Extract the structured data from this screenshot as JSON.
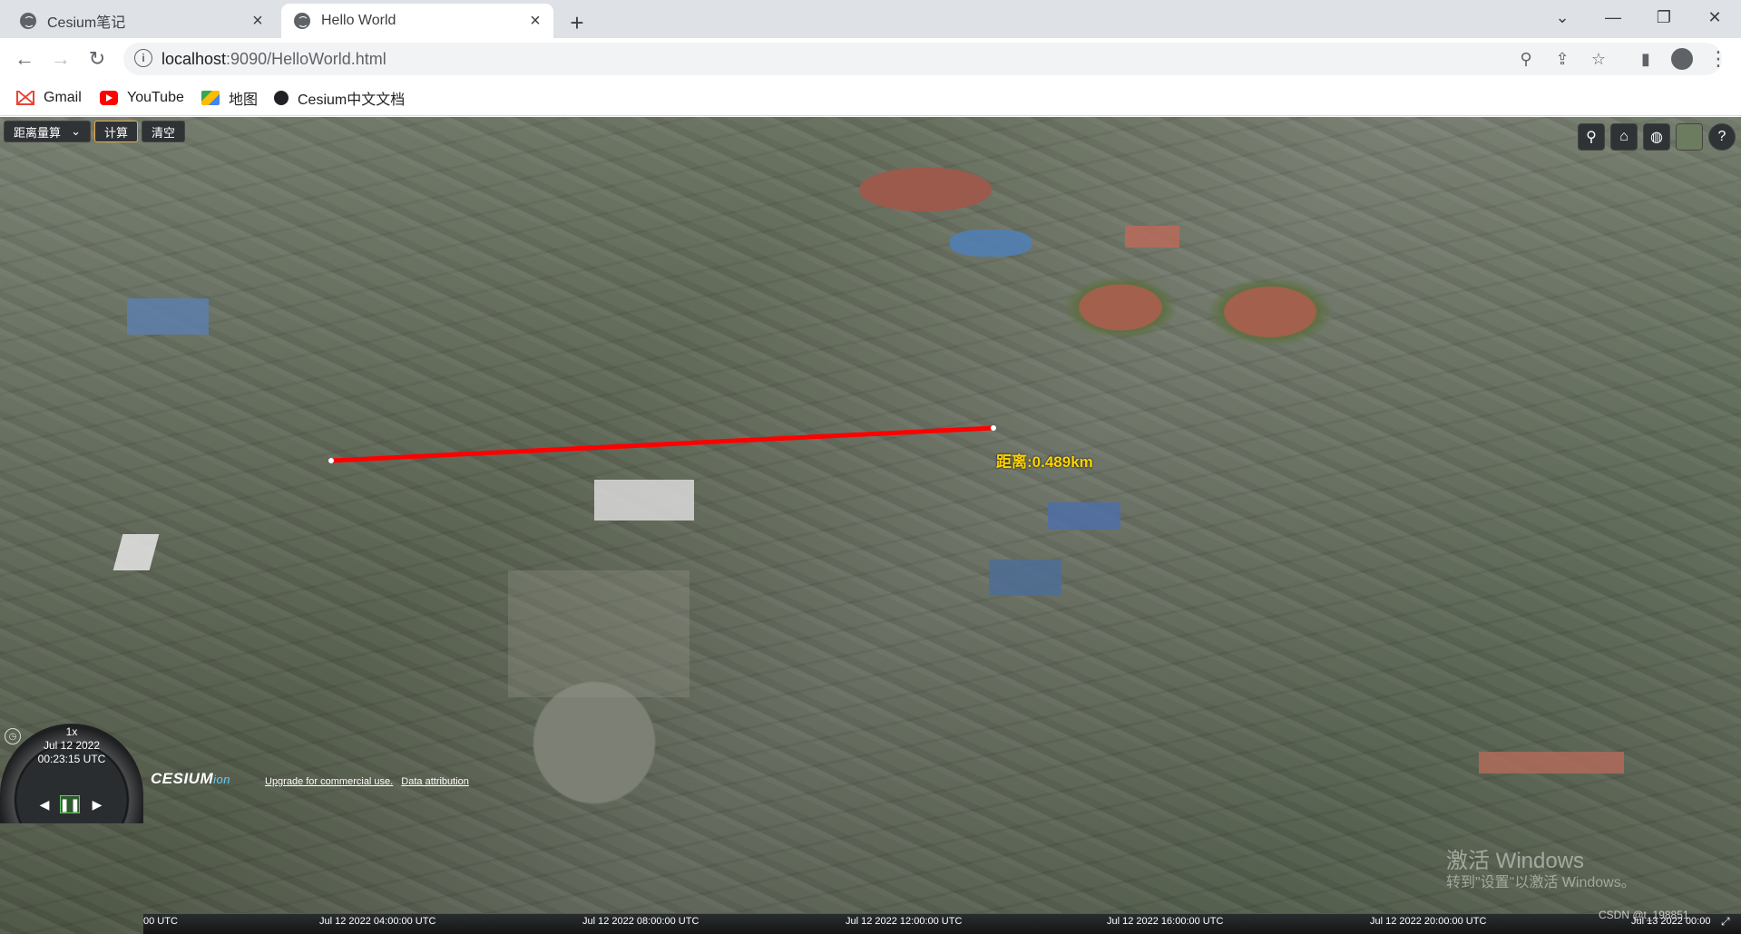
{
  "browser": {
    "tabs": [
      {
        "label": "Cesium笔记",
        "active": false
      },
      {
        "label": "Hello World",
        "active": true
      }
    ],
    "new_tab_icon": "plus-icon",
    "url_host": "localhost",
    "url_rest": ":9090/HelloWorld.html",
    "bookmarks": [
      {
        "label": "Gmail",
        "icon": "gmail-icon"
      },
      {
        "label": "YouTube",
        "icon": "youtube-icon"
      },
      {
        "label": "地图",
        "icon": "maps-icon"
      },
      {
        "label": "Cesium中文文档",
        "icon": "cesium-icon"
      }
    ]
  },
  "cesium": {
    "mode_select": "距离量算",
    "calc_button": "计算",
    "clear_button": "清空",
    "distance_label": "距离:0.489km",
    "animation": {
      "speed": "1x",
      "date": "Jul 12 2022",
      "time": "00:23:15 UTC"
    },
    "logo": "CESIUM",
    "logo_suffix": "ion",
    "credits": [
      "Upgrade for commercial use.",
      "Data attribution"
    ],
    "timeline_ticks": [
      "00 UTC",
      "Jul 12 2022 04:00:00 UTC",
      "Jul 12 2022 08:00:00 UTC",
      "Jul 12 2022 12:00:00 UTC",
      "Jul 12 2022 16:00:00 UTC",
      "Jul 12 2022 20:00:00 UTC",
      "Jul 13 2022 00:00"
    ]
  },
  "overlay": {
    "windows_watermark_title": "激活 Windows",
    "windows_watermark_sub": "转到\"设置\"以激活 Windows。",
    "csdn_watermark": "CSDN @t_198851"
  },
  "colors": {
    "measure_line": "#ff0000",
    "label": "#ffd400"
  }
}
